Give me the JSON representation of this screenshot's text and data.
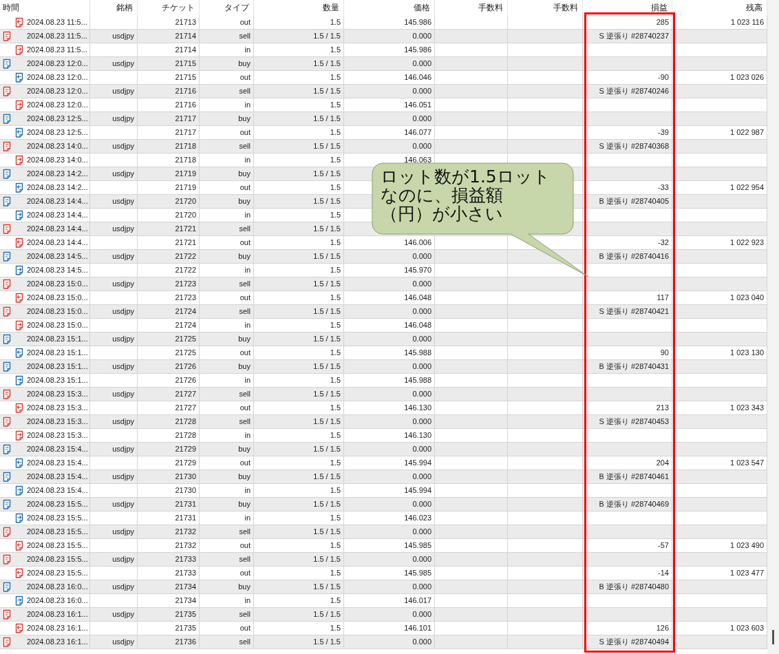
{
  "columns": [
    "時間",
    "銘柄",
    "チケット",
    "タイプ",
    "数量",
    "価格",
    "手数料",
    "手数料",
    "損益",
    "残高"
  ],
  "rows": [
    {
      "kind": "deal_out",
      "color": "#e0392e",
      "time": "2024.08.23 11:5...",
      "ticket": "21713",
      "type": "out",
      "volume": "1.5",
      "price": "145.986",
      "profit": "285",
      "balance": "1 023 116"
    },
    {
      "kind": "order",
      "color": "#e0392e",
      "time": "2024.08.23 11:5...",
      "symbol": "usdjpy",
      "ticket": "21714",
      "type": "sell",
      "volume": "1.5 / 1.5",
      "price": "0.000",
      "profit": "S 逆張り #28740237"
    },
    {
      "kind": "deal_in",
      "color": "#e0392e",
      "time": "2024.08.23 11:5...",
      "ticket": "21714",
      "type": "in",
      "volume": "1.5",
      "price": "145.986"
    },
    {
      "kind": "order",
      "color": "#1f6fb8",
      "time": "2024.08.23 12:0...",
      "symbol": "usdjpy",
      "ticket": "21715",
      "type": "buy",
      "volume": "1.5 / 1.5",
      "price": "0.000"
    },
    {
      "kind": "deal_out",
      "color": "#1f6fb8",
      "time": "2024.08.23 12:0...",
      "ticket": "21715",
      "type": "out",
      "volume": "1.5",
      "price": "146.046",
      "profit": "-90",
      "balance": "1 023 026"
    },
    {
      "kind": "order",
      "color": "#e0392e",
      "time": "2024.08.23 12:0...",
      "symbol": "usdjpy",
      "ticket": "21716",
      "type": "sell",
      "volume": "1.5 / 1.5",
      "price": "0.000",
      "profit": "S 逆張り #28740246"
    },
    {
      "kind": "deal_in",
      "color": "#e0392e",
      "time": "2024.08.23 12:0...",
      "ticket": "21716",
      "type": "in",
      "volume": "1.5",
      "price": "146.051"
    },
    {
      "kind": "order",
      "color": "#1f6fb8",
      "time": "2024.08.23 12:5...",
      "symbol": "usdjpy",
      "ticket": "21717",
      "type": "buy",
      "volume": "1.5 / 1.5",
      "price": "0.000"
    },
    {
      "kind": "deal_out",
      "color": "#1f6fb8",
      "time": "2024.08.23 12:5...",
      "ticket": "21717",
      "type": "out",
      "volume": "1.5",
      "price": "146.077",
      "profit": "-39",
      "balance": "1 022 987"
    },
    {
      "kind": "order",
      "color": "#e0392e",
      "time": "2024.08.23 14:0...",
      "symbol": "usdjpy",
      "ticket": "21718",
      "type": "sell",
      "volume": "1.5 / 1.5",
      "price": "0.000",
      "profit": "S 逆張り #28740368"
    },
    {
      "kind": "deal_in",
      "color": "#e0392e",
      "time": "2024.08.23 14:0...",
      "ticket": "21718",
      "type": "in",
      "volume": "1.5",
      "price": "146.063"
    },
    {
      "kind": "order",
      "color": "#1f6fb8",
      "time": "2024.08.23 14:2...",
      "symbol": "usdjpy",
      "ticket": "21719",
      "type": "buy",
      "volume": "1.5 / 1.5"
    },
    {
      "kind": "deal_out",
      "color": "#1f6fb8",
      "time": "2024.08.23 14:2...",
      "ticket": "21719",
      "type": "out",
      "volume": "1.5",
      "profit": "-33",
      "balance": "1 022 954"
    },
    {
      "kind": "order",
      "color": "#1f6fb8",
      "time": "2024.08.23 14:4...",
      "symbol": "usdjpy",
      "ticket": "21720",
      "type": "buy",
      "volume": "1.5 / 1.5",
      "profit": "B 逆張り #28740405"
    },
    {
      "kind": "deal_in",
      "color": "#1f6fb8",
      "time": "2024.08.23 14:4...",
      "ticket": "21720",
      "type": "in",
      "volume": "1.5"
    },
    {
      "kind": "order",
      "color": "#e0392e",
      "time": "2024.08.23 14:4...",
      "symbol": "usdjpy",
      "ticket": "21721",
      "type": "sell",
      "volume": "1.5 / 1.5"
    },
    {
      "kind": "deal_out",
      "color": "#e0392e",
      "time": "2024.08.23 14:4...",
      "ticket": "21721",
      "type": "out",
      "volume": "1.5",
      "price": "146.006",
      "profit": "-32",
      "balance": "1 022 923"
    },
    {
      "kind": "order",
      "color": "#1f6fb8",
      "time": "2024.08.23 14:5...",
      "symbol": "usdjpy",
      "ticket": "21722",
      "type": "buy",
      "volume": "1.5 / 1.5",
      "price": "0.000",
      "profit": "B 逆張り #28740416"
    },
    {
      "kind": "deal_in",
      "color": "#1f6fb8",
      "time": "2024.08.23 14:5...",
      "ticket": "21722",
      "type": "in",
      "volume": "1.5",
      "price": "145.970"
    },
    {
      "kind": "order",
      "color": "#e0392e",
      "time": "2024.08.23 15:0...",
      "symbol": "usdjpy",
      "ticket": "21723",
      "type": "sell",
      "volume": "1.5 / 1.5",
      "price": "0.000"
    },
    {
      "kind": "deal_out",
      "color": "#e0392e",
      "time": "2024.08.23 15:0...",
      "ticket": "21723",
      "type": "out",
      "volume": "1.5",
      "price": "146.048",
      "profit": "117",
      "balance": "1 023 040"
    },
    {
      "kind": "order",
      "color": "#e0392e",
      "time": "2024.08.23 15:0...",
      "symbol": "usdjpy",
      "ticket": "21724",
      "type": "sell",
      "volume": "1.5 / 1.5",
      "price": "0.000",
      "profit": "S 逆張り #28740421"
    },
    {
      "kind": "deal_in",
      "color": "#e0392e",
      "time": "2024.08.23 15:0...",
      "ticket": "21724",
      "type": "in",
      "volume": "1.5",
      "price": "146.048"
    },
    {
      "kind": "order",
      "color": "#1f6fb8",
      "time": "2024.08.23 15:1...",
      "symbol": "usdjpy",
      "ticket": "21725",
      "type": "buy",
      "volume": "1.5 / 1.5",
      "price": "0.000"
    },
    {
      "kind": "deal_out",
      "color": "#1f6fb8",
      "time": "2024.08.23 15:1...",
      "ticket": "21725",
      "type": "out",
      "volume": "1.5",
      "price": "145.988",
      "profit": "90",
      "balance": "1 023 130"
    },
    {
      "kind": "order",
      "color": "#1f6fb8",
      "time": "2024.08.23 15:1...",
      "symbol": "usdjpy",
      "ticket": "21726",
      "type": "buy",
      "volume": "1.5 / 1.5",
      "price": "0.000",
      "profit": "B 逆張り #28740431"
    },
    {
      "kind": "deal_in",
      "color": "#1f6fb8",
      "time": "2024.08.23 15:1...",
      "ticket": "21726",
      "type": "in",
      "volume": "1.5",
      "price": "145.988"
    },
    {
      "kind": "order",
      "color": "#e0392e",
      "time": "2024.08.23 15:3...",
      "symbol": "usdjpy",
      "ticket": "21727",
      "type": "sell",
      "volume": "1.5 / 1.5",
      "price": "0.000"
    },
    {
      "kind": "deal_out",
      "color": "#e0392e",
      "time": "2024.08.23 15:3...",
      "ticket": "21727",
      "type": "out",
      "volume": "1.5",
      "price": "146.130",
      "profit": "213",
      "balance": "1 023 343"
    },
    {
      "kind": "order",
      "color": "#e0392e",
      "time": "2024.08.23 15:3...",
      "symbol": "usdjpy",
      "ticket": "21728",
      "type": "sell",
      "volume": "1.5 / 1.5",
      "price": "0.000",
      "profit": "S 逆張り #28740453"
    },
    {
      "kind": "deal_in",
      "color": "#e0392e",
      "time": "2024.08.23 15:3...",
      "ticket": "21728",
      "type": "in",
      "volume": "1.5",
      "price": "146.130"
    },
    {
      "kind": "order",
      "color": "#1f6fb8",
      "time": "2024.08.23 15:4...",
      "symbol": "usdjpy",
      "ticket": "21729",
      "type": "buy",
      "volume": "1.5 / 1.5",
      "price": "0.000"
    },
    {
      "kind": "deal_out",
      "color": "#1f6fb8",
      "time": "2024.08.23 15:4...",
      "ticket": "21729",
      "type": "out",
      "volume": "1.5",
      "price": "145.994",
      "profit": "204",
      "balance": "1 023 547"
    },
    {
      "kind": "order",
      "color": "#1f6fb8",
      "time": "2024.08.23 15:4...",
      "symbol": "usdjpy",
      "ticket": "21730",
      "type": "buy",
      "volume": "1.5 / 1.5",
      "price": "0.000",
      "profit": "B 逆張り #28740461"
    },
    {
      "kind": "deal_in",
      "color": "#1f6fb8",
      "time": "2024.08.23 15:4...",
      "ticket": "21730",
      "type": "in",
      "volume": "1.5",
      "price": "145.994"
    },
    {
      "kind": "order",
      "color": "#1f6fb8",
      "time": "2024.08.23 15:5...",
      "symbol": "usdjpy",
      "ticket": "21731",
      "type": "buy",
      "volume": "1.5 / 1.5",
      "price": "0.000",
      "profit": "B 逆張り #28740469"
    },
    {
      "kind": "deal_in",
      "color": "#1f6fb8",
      "time": "2024.08.23 15:5...",
      "ticket": "21731",
      "type": "in",
      "volume": "1.5",
      "price": "146.023"
    },
    {
      "kind": "order",
      "color": "#e0392e",
      "time": "2024.08.23 15:5...",
      "symbol": "usdjpy",
      "ticket": "21732",
      "type": "sell",
      "volume": "1.5 / 1.5",
      "price": "0.000"
    },
    {
      "kind": "deal_out",
      "color": "#e0392e",
      "time": "2024.08.23 15:5...",
      "ticket": "21732",
      "type": "out",
      "volume": "1.5",
      "price": "145.985",
      "profit": "-57",
      "balance": "1 023 490"
    },
    {
      "kind": "order",
      "color": "#e0392e",
      "time": "2024.08.23 15:5...",
      "symbol": "usdjpy",
      "ticket": "21733",
      "type": "sell",
      "volume": "1.5 / 1.5",
      "price": "0.000"
    },
    {
      "kind": "deal_out",
      "color": "#e0392e",
      "time": "2024.08.23 15:5...",
      "ticket": "21733",
      "type": "out",
      "volume": "1.5",
      "price": "145.985",
      "profit": "-14",
      "balance": "1 023 477"
    },
    {
      "kind": "order",
      "color": "#1f6fb8",
      "time": "2024.08.23 16:0...",
      "symbol": "usdjpy",
      "ticket": "21734",
      "type": "buy",
      "volume": "1.5 / 1.5",
      "price": "0.000",
      "profit": "B 逆張り #28740480"
    },
    {
      "kind": "deal_in",
      "color": "#1f6fb8",
      "time": "2024.08.23 16:0...",
      "ticket": "21734",
      "type": "in",
      "volume": "1.5",
      "price": "146.017"
    },
    {
      "kind": "order",
      "color": "#e0392e",
      "time": "2024.08.23 16:1...",
      "symbol": "usdjpy",
      "ticket": "21735",
      "type": "sell",
      "volume": "1.5 / 1.5",
      "price": "0.000"
    },
    {
      "kind": "deal_out",
      "color": "#e0392e",
      "time": "2024.08.23 16:1...",
      "ticket": "21735",
      "type": "out",
      "volume": "1.5",
      "price": "146.101",
      "profit": "126",
      "balance": "1 023 603"
    },
    {
      "kind": "order",
      "color": "#e0392e",
      "time": "2024.08.23 16:1...",
      "symbol": "usdjpy",
      "ticket": "21736",
      "type": "sell",
      "volume": "1.5 / 1.5",
      "price": "0.000",
      "profit": "S 逆張り #28740494"
    }
  ],
  "callout": {
    "lines": [
      "ロット数が1.5ロット",
      "なのに、損益額",
      "（円）が小さい"
    ]
  }
}
